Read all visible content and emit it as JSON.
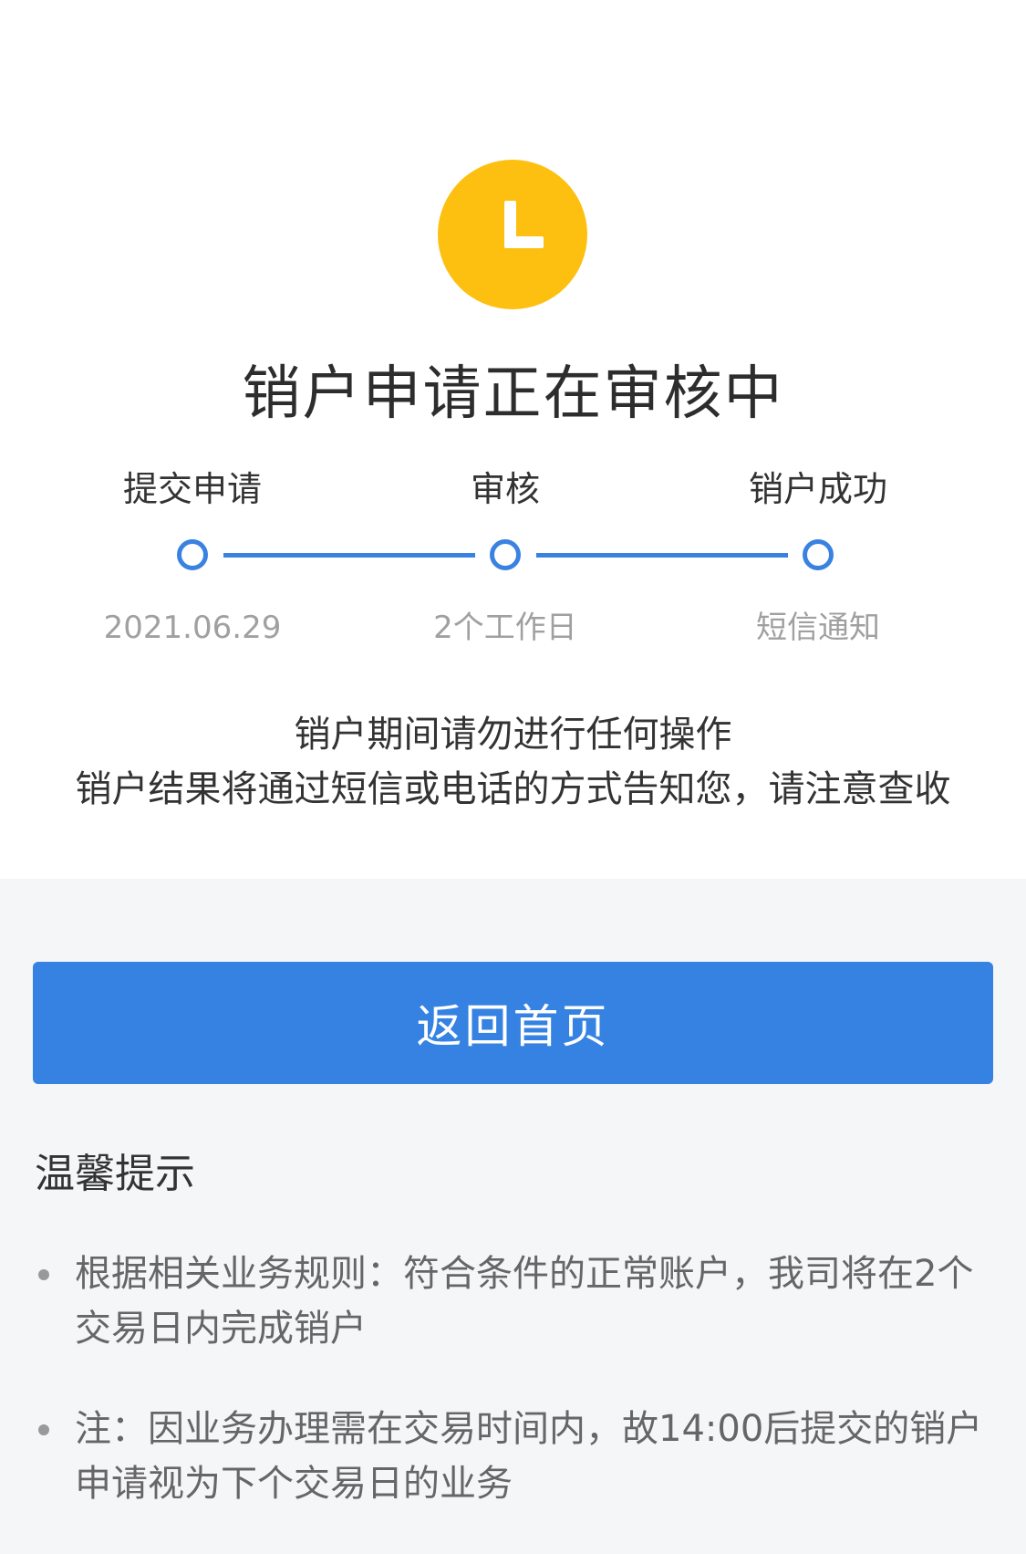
{
  "status": {
    "icon": "clock-icon",
    "icon_color": "#fdc010",
    "title": "销户申请正在审核中"
  },
  "steps": [
    {
      "label": "提交申请",
      "sub": "2021.06.29"
    },
    {
      "label": "审核",
      "sub": "2个工作日"
    },
    {
      "label": "销户成功",
      "sub": "短信通知"
    }
  ],
  "accent_color": "#3a82e1",
  "notes": {
    "line1": "销户期间请勿进行任何操作",
    "line2": "销户结果将通过短信或电话的方式告知您，请注意查收"
  },
  "home_button": {
    "label": "返回首页"
  },
  "tips": {
    "heading": "温馨提示",
    "items": [
      "根据相关业务规则：符合条件的正常账户，我司将在2个交易日内完成销户",
      "注：因业务办理需在交易时间内，故14:00后提交的销户申请视为下个交易日的业务"
    ]
  }
}
